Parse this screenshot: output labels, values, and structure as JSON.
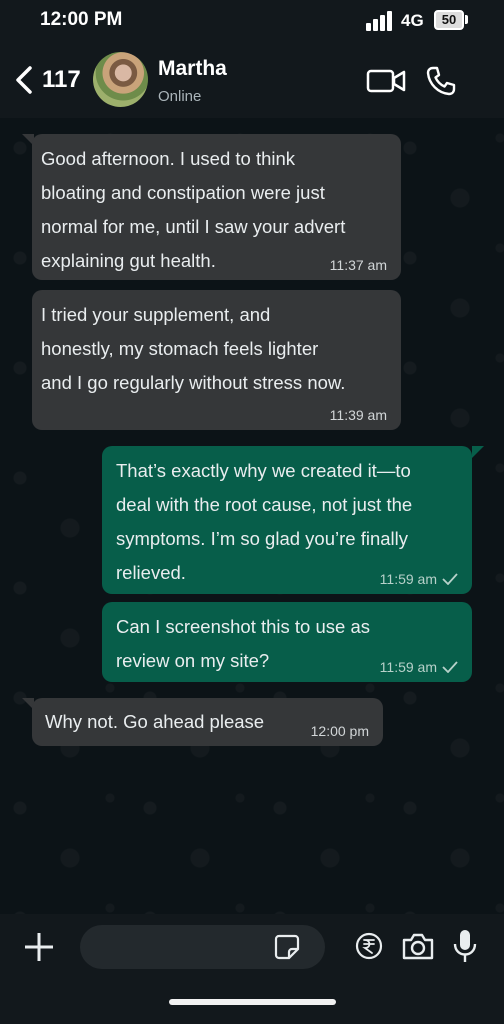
{
  "status_bar": {
    "time": "12:00 PM",
    "network": "4G",
    "battery": "50"
  },
  "header": {
    "unread_count": "117",
    "contact_name": "Martha",
    "presence": "Online"
  },
  "messages": [
    {
      "direction": "incoming",
      "text": "Good afternoon. I used to think\nbloating and constipation were just\nnormal for me, until I saw your advert\nexplaining gut health.",
      "time": "11:37 am"
    },
    {
      "direction": "incoming",
      "text": "I tried your supplement, and\nhonestly, my stomach feels lighter\nand I go regularly without stress now.",
      "time": "11:39 am"
    },
    {
      "direction": "outgoing",
      "text": "That’s exactly why we created it—to\ndeal with the root cause, not just the\nsymptoms. I’m so glad you’re finally\nrelieved.",
      "time": "11:59 am",
      "status": "delivered"
    },
    {
      "direction": "outgoing",
      "text": "Can I screenshot this to use as\nreview on my site?",
      "time": "11:59 am",
      "status": "delivered"
    },
    {
      "direction": "incoming",
      "text": "Why not. Go ahead please",
      "time": "12:00 pm"
    }
  ],
  "composer": {
    "placeholder": ""
  },
  "icons": {
    "back": "chevron-left-icon",
    "video": "video-camera-icon",
    "call": "phone-icon",
    "attach": "plus-icon",
    "sticker": "sticker-icon",
    "payment": "rupee-icon",
    "camera": "camera-icon",
    "mic": "microphone-icon",
    "tick": "check-icon"
  },
  "colors": {
    "incoming_bubble": "#353739",
    "outgoing_bubble": "#075e4a",
    "background": "#0c1317"
  }
}
